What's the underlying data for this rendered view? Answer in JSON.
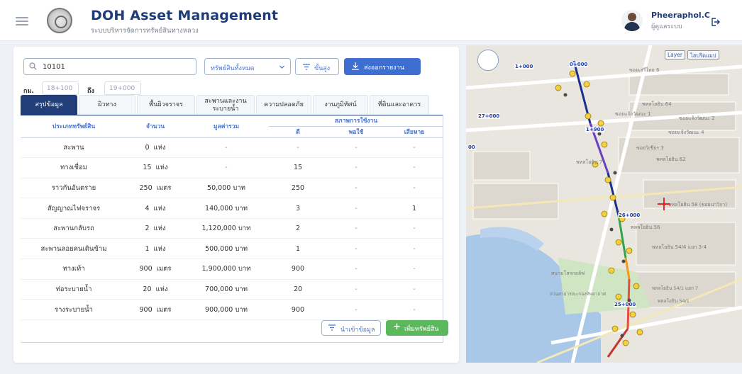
{
  "header": {
    "app_title": "DOH Asset Management",
    "app_subtitle": "ระบบบริหารจัดการทรัพย์สินทางหลวง",
    "user_name": "Pheeraphol.C",
    "user_role": "ผู้ดูแลระบบ"
  },
  "search": {
    "value": "10101",
    "asset_filter": "ทรัพย์สินทั้งหมด",
    "advanced_label": "ขั้นสูง",
    "export_label": "ส่งออกรายงาน"
  },
  "km_range": {
    "from_label": "กม.",
    "from_value": "18+100",
    "to_label": "ถึง",
    "to_value": "19+000"
  },
  "tabs": [
    {
      "label": "สรุปข้อมูล",
      "active": true
    },
    {
      "label": "ผิวทาง"
    },
    {
      "label": "พื้นผิวจราจร"
    },
    {
      "label": "สะพานและงานระบายน้ำ"
    },
    {
      "label": "ความปลอดภัย"
    },
    {
      "label": "งานภูมิทัศน์"
    },
    {
      "label": "ที่ดินและอาคาร"
    }
  ],
  "table": {
    "headers": {
      "type": "ประเภททรัพย์สิน",
      "qty": "จำนวน",
      "value": "มูลค่ารวม",
      "condition_group": "สภาพการใช้งาน",
      "good": "ดี",
      "fair": "พอใช้",
      "damaged": "เสียหาย"
    },
    "rows": [
      {
        "type": "สะพาน",
        "qty": "0",
        "unit": "แห่ง",
        "value": "-",
        "good": "-",
        "fair": "-",
        "damaged": "-"
      },
      {
        "type": "ทางเชื่อม",
        "qty": "15",
        "unit": "แห่ง",
        "value": "-",
        "good": "15",
        "fair": "-",
        "damaged": "-"
      },
      {
        "type": "ราวกันอันตราย",
        "qty": "250",
        "unit": "เมตร",
        "value": "50,000 บาท",
        "good": "250",
        "fair": "-",
        "damaged": "-"
      },
      {
        "type": "สัญญาณไฟจราจร",
        "qty": "4",
        "unit": "แห่ง",
        "value": "140,000 บาท",
        "good": "3",
        "fair": "-",
        "damaged": "1"
      },
      {
        "type": "สะพานกลับรถ",
        "qty": "2",
        "unit": "แห่ง",
        "value": "1,120,000 บาท",
        "good": "2",
        "fair": "-",
        "damaged": "-"
      },
      {
        "type": "สะพานลอยคนเดินข้าม",
        "qty": "1",
        "unit": "แห่ง",
        "value": "500,000 บาท",
        "good": "1",
        "fair": "-",
        "damaged": "-"
      },
      {
        "type": "ทางเท้า",
        "qty": "900",
        "unit": "เมตร",
        "value": "1,900,000 บาท",
        "good": "900",
        "fair": "-",
        "damaged": "-"
      },
      {
        "type": "ท่อระบายน้ำ",
        "qty": "20",
        "unit": "แห่ง",
        "value": "700,000 บาท",
        "good": "20",
        "fair": "-",
        "damaged": "-"
      },
      {
        "type": "รางระบายน้ำ",
        "qty": "900",
        "unit": "เมตร",
        "value": "900,000 บาท",
        "good": "900",
        "fair": "-",
        "damaged": "-"
      }
    ]
  },
  "actions": {
    "import_label": "นำเข้าข้อมูล",
    "add_label": "เพิ่มทรัพย์สิน"
  },
  "map": {
    "layer_button": "Layer",
    "base_button": "ไฮบริดแมป",
    "km_markers": [
      "1+000",
      "0+000",
      "27+000",
      "1+900",
      "26+000",
      "25+000",
      "00"
    ],
    "street_labels": [
      "ซอยเสรีไทย 6",
      "พหลโยธิน 64",
      "ซอยแจ้งวัฒนะ 1",
      "ซอยแจ้งวัฒนะ 2",
      "ซอยแจ้งวัฒนะ 4",
      "ซอยวิเชียร 3",
      "พหลโยธิน 62",
      "พหลโยธิน 77",
      "พหลโยธิน 58 (ชอยนาวิกา)",
      "พหลโยธิน 56",
      "พหลโยธิน 54/4 แยก 3-4",
      "สนามโสรกอล์ฟ",
      "สวนสาธารณะกองทัพอากาศ",
      "พหลโยธิน 54/1 แยก 7",
      "พหลโยธิน 54/1"
    ],
    "route_colors": [
      "#1d2f8c",
      "#6a3fc0",
      "#33a34a",
      "#f39c12",
      "#e74c3c",
      "#c0392b"
    ],
    "pin_color": "#f4d03f"
  }
}
